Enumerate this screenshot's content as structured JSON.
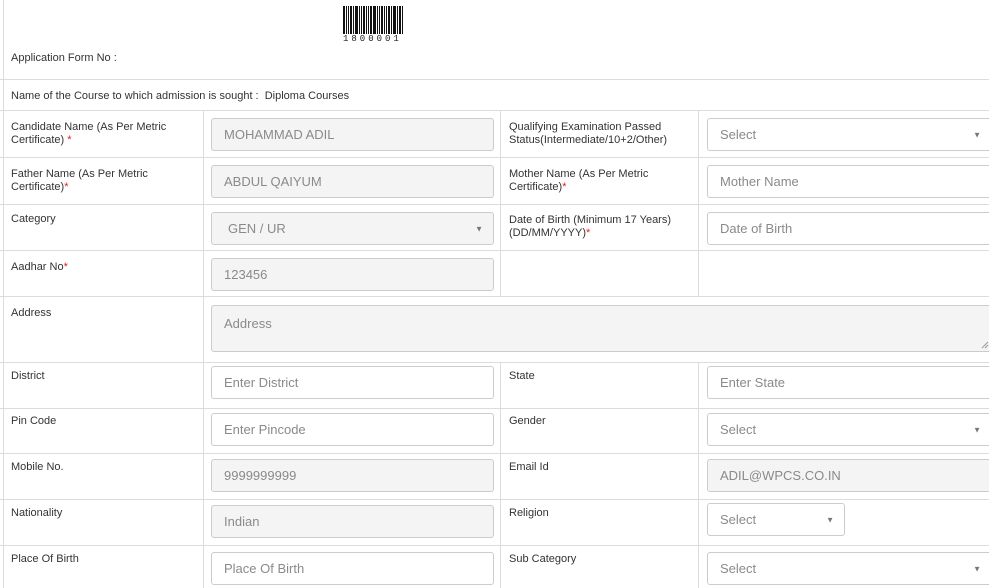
{
  "header": {
    "app_form_label": "Application Form No :",
    "form_number": "1800001",
    "course_text": "Name of the Course to which admission is sought :  Diploma Courses"
  },
  "rows": {
    "candidate_label": "Candidate Name (As Per Metric",
    "candidate_label2": "Certificate)",
    "candidate_value": "MOHAMMAD ADIL",
    "qualifying_label": "Qualifying Examination Passed",
    "qualifying_label2": "Status(Intermediate/10+2/Other)",
    "qualifying_value": "Select",
    "father_label": "Father Name (As Per Metric",
    "father_label2": "Certificate)",
    "father_value": "ABDUL QAIYUM",
    "mother_label": "Mother Name (As Per Metric",
    "mother_label2": "Certificate)",
    "mother_placeholder": "Mother Name",
    "category_label": "Category",
    "category_value": "GEN / UR",
    "dob_label": "Date of Birth (Minimum 17 Years)",
    "dob_label2": "(DD/MM/YYYY)",
    "dob_placeholder": "Date of Birth",
    "aadhar_label": "Aadhar No",
    "aadhar_value": "123456",
    "address_label": "Address",
    "address_placeholder": "Address",
    "district_label": "District",
    "district_placeholder": "Enter District",
    "state_label": "State",
    "state_placeholder": "Enter State",
    "pin_label": "Pin Code",
    "pin_placeholder": "Enter Pincode",
    "gender_label": "Gender",
    "gender_value": "Select",
    "mobile_label": "Mobile No.",
    "mobile_value": "9999999999",
    "email_label": "Email Id",
    "email_value": "ADIL@WPCS.CO.IN",
    "nationality_label": "Nationality",
    "nationality_value": "Indian",
    "religion_label": "Religion",
    "religion_value": "Select",
    "pob_label": "Place Of Birth",
    "pob_placeholder": "Place Of Birth",
    "subcat_label": "Sub Category",
    "subcat_value": "Select"
  },
  "marks": {
    "required": "*"
  }
}
